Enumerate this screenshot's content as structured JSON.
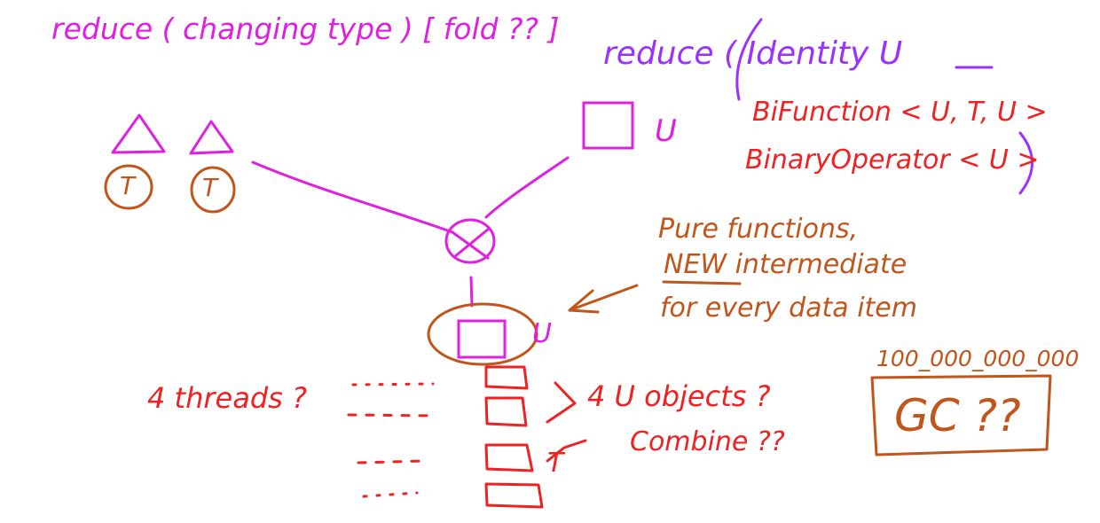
{
  "colors": {
    "magenta": "#e020e0",
    "purple": "#9b30ff",
    "red": "#ee2222",
    "brown": "#c0561b"
  },
  "annotations": {
    "reduce_changing_type": "reduce ( changing type ) [ fold ?? ]",
    "reduce_identity": "reduce ( Identity U",
    "bifunction": "BiFunction < U, T, U >",
    "binary_operator": "BinaryOperator < U >",
    "t_label_1": "T",
    "t_label_2": "T",
    "u_label_top": "U",
    "u_label_mid": "U",
    "pure_functions": "Pure functions,",
    "new_intermediate": "NEW intermediate",
    "for_every_item": "for every data item",
    "big_number": "100_000_000_000",
    "gc": "GC ??",
    "threads": "4 threads ?",
    "u_objects": "4 U objects ?",
    "combine": "Combine ??",
    "t_small": "T"
  }
}
